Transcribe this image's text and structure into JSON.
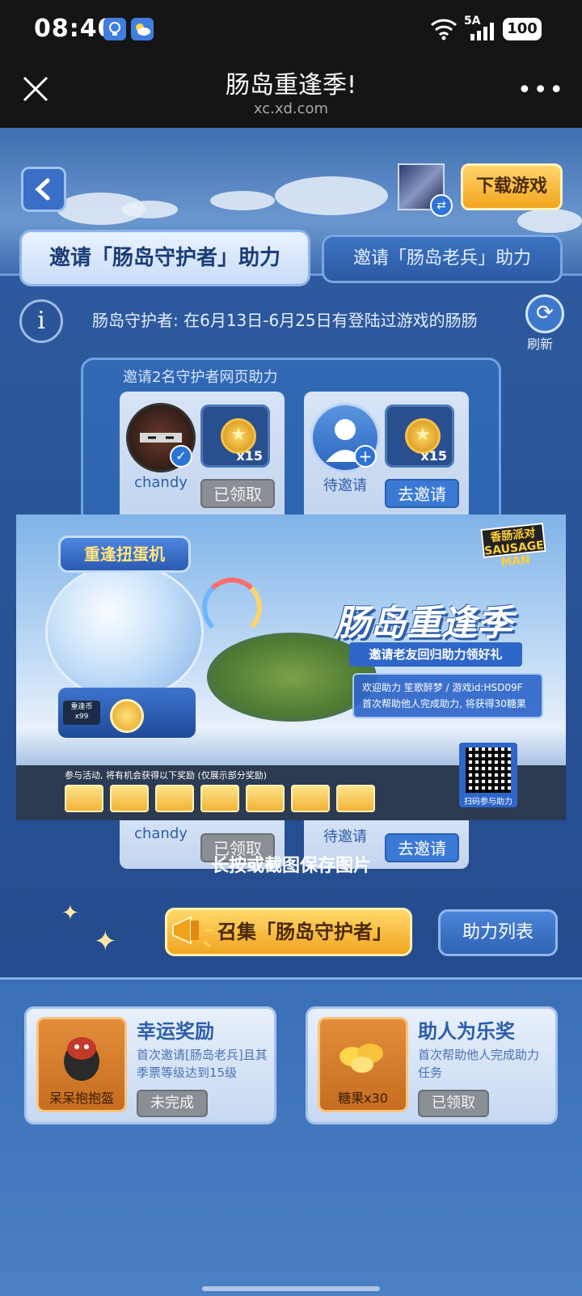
{
  "status_bar": {
    "time": "08:40",
    "network": "5A",
    "battery": "100"
  },
  "title_bar": {
    "title": "肠岛重逢季!",
    "url": "xc.xd.com"
  },
  "header": {
    "download_label": "下载游戏"
  },
  "tabs": [
    {
      "label": "邀请「肠岛守护者」助力",
      "active": true
    },
    {
      "label": "邀请「肠岛老兵」助力",
      "active": false
    }
  ],
  "info": {
    "icon_text": "i",
    "text": "肠岛守护者: 在6月13日-6月25日有登陆过游戏的肠肠",
    "refresh_label": "刷新"
  },
  "invite_section": {
    "header": "邀请2名守护者网页助力",
    "cards": [
      {
        "name": "chandy",
        "reward_count": "x15",
        "button": "已领取"
      },
      {
        "name": "待邀请",
        "reward_count": "x15",
        "button": "去邀请"
      }
    ],
    "lower_cards": [
      {
        "name": "chandy",
        "button": "已领取"
      },
      {
        "name": "待邀请",
        "button": "去邀请"
      }
    ]
  },
  "poster": {
    "machine_title": "重逢扭蛋机",
    "logo": "香肠派对 SAUSAGE MAN",
    "main_title": "肠岛重逢季",
    "sub_banner": "邀请老友回归助力领好礼",
    "welcome_line1": "欢迎助力 笙歌醉梦 / 游戏id:HSD09F",
    "welcome_line2": "首次帮助他人完成助力, 将获得30糖果",
    "participate_text": "参与活动, 将有机会获得以下奖励 (仅展示部分奖励)",
    "ball_count": "重逢币 x99",
    "qr_label": "扫码参与助力"
  },
  "save_hint": "长按或截图保存图片",
  "actions": {
    "collect_label": "召集「肠岛守护者」",
    "list_label": "助力列表"
  },
  "bottom_rewards": [
    {
      "title": "幸运奖励",
      "desc": "首次邀请[肠岛老兵]且其季票等级达到15级",
      "item": "呆呆抱抱盔",
      "button": "未完成"
    },
    {
      "title": "助人为乐奖",
      "desc": "首次帮助他人完成助力任务",
      "item": "糖果x30",
      "button": "已领取"
    }
  ],
  "colors": {
    "brand_gold": "#f2a51f",
    "panel_blue": "#2b5ea8",
    "claimed_grey": "#8a8f96",
    "invite_blue": "#3b7ad4"
  }
}
